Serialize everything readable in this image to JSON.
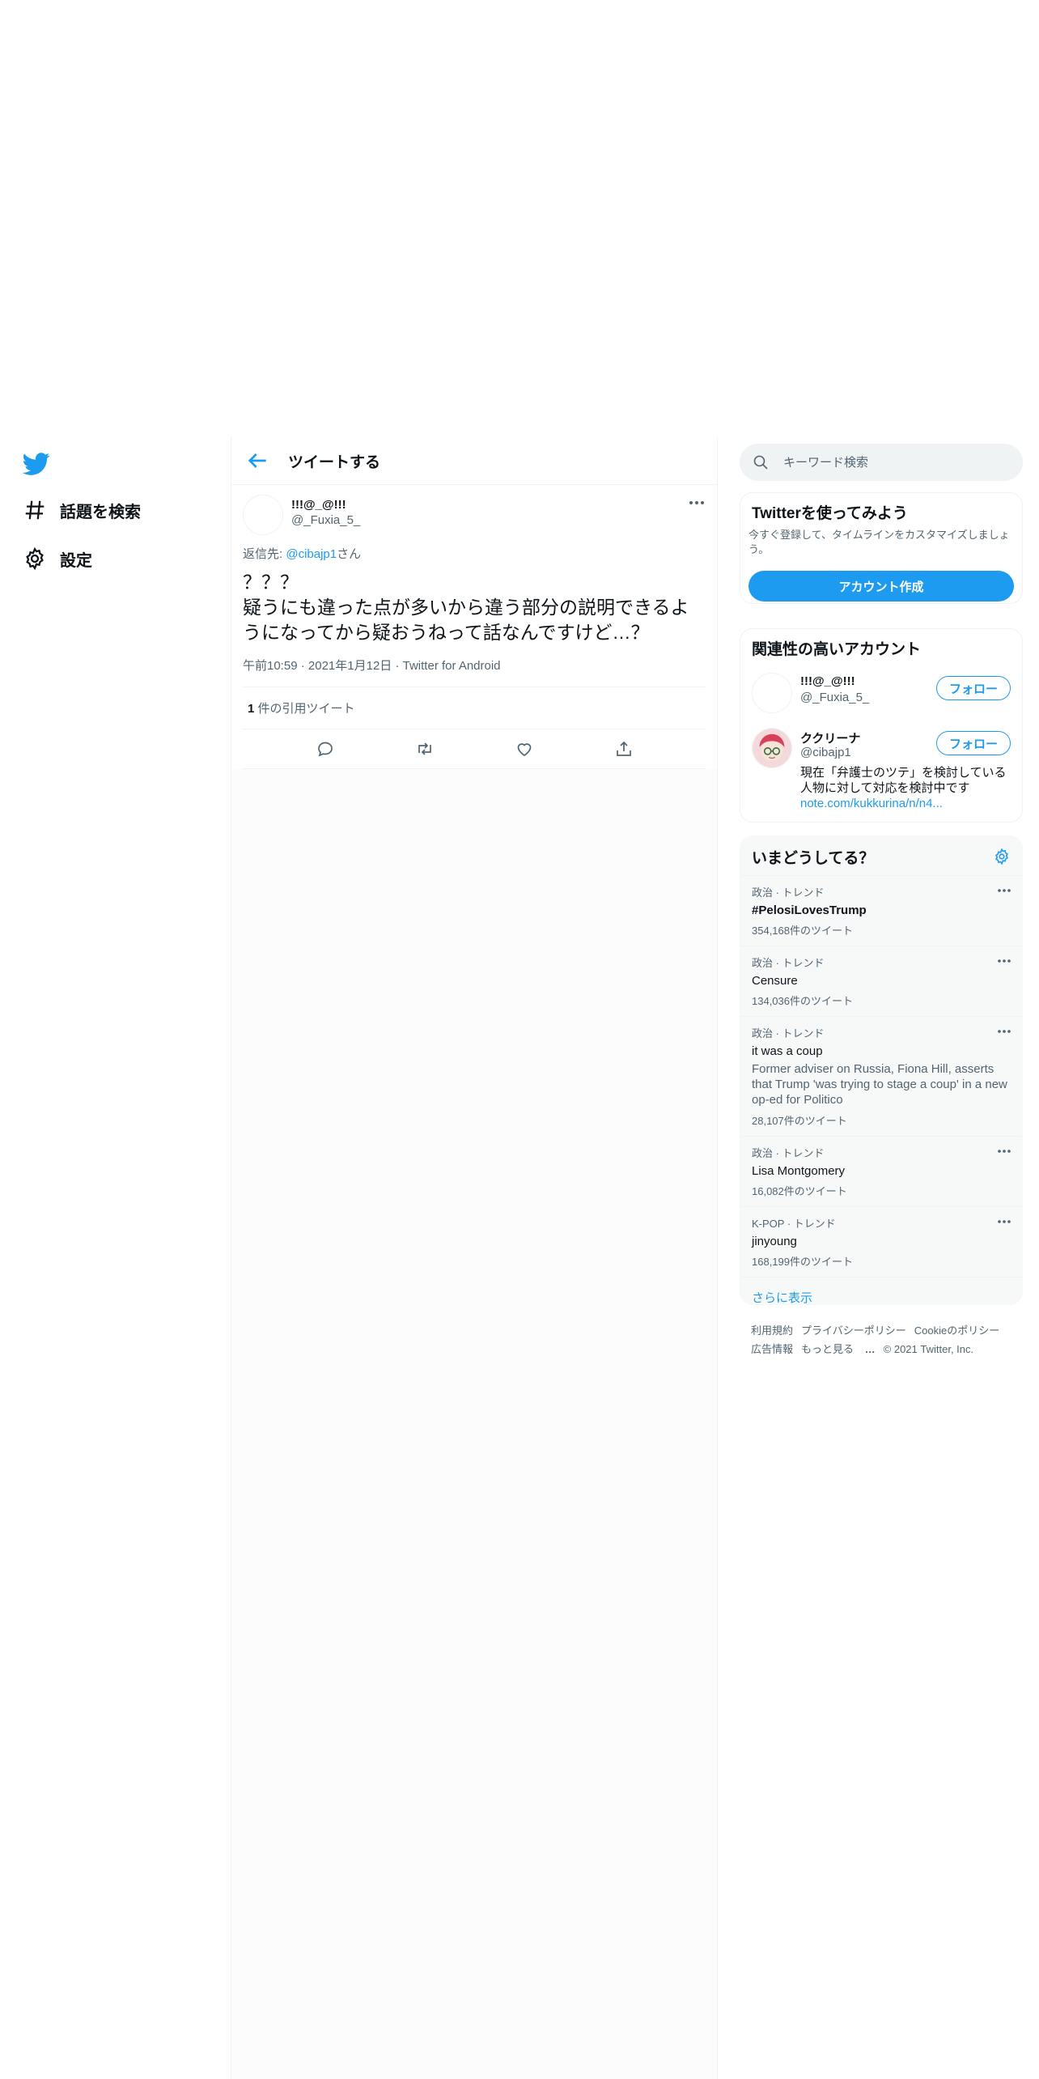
{
  "nav": {
    "explore_label": "話題を検索",
    "settings_label": "設定"
  },
  "header": {
    "title": "ツイートする"
  },
  "tweet": {
    "name": "!!!@_@!!!",
    "handle": "@_Fuxia_5_",
    "reply_prefix": "返信先: ",
    "reply_handle": "@cibajp1",
    "reply_suffix": "さん",
    "text": "？？？\n疑うにも違った点が多いから違う部分の説明できるようになってから疑おうねって話なんですけど…？",
    "time": "午前10:59",
    "date": "2021年1月12日",
    "source": "Twitter for Android",
    "quote_count": "1",
    "quote_label": " 件の引用ツイート"
  },
  "search": {
    "placeholder": "キーワード検索"
  },
  "signup": {
    "title": "Twitterを使ってみよう",
    "subtitle": "今すぐ登録して、タイムラインをカスタマイズしましょう。",
    "button": "アカウント作成"
  },
  "related": {
    "title": "関連性の高いアカウント",
    "follow_label": "フォロー",
    "accounts": [
      {
        "name": "!!!@_@!!!",
        "handle": "@_Fuxia_5_"
      },
      {
        "name": "ククリーナ",
        "handle": "@cibajp1",
        "bio": "現在「弁護士のツテ」を検討している人物に対して対応を検討中です",
        "link": "note.com/kukkurina/n/n4..."
      }
    ]
  },
  "trends": {
    "title": "いまどうしてる？",
    "items": [
      {
        "category": "政治 · トレンド",
        "name": "#PelosiLovesTrump",
        "count": "354,168件のツイート"
      },
      {
        "category": "政治 · トレンド",
        "name": "Censure",
        "count": "134,036件のツイート"
      },
      {
        "category": "政治 · トレンド",
        "name": "it was a coup",
        "desc": "Former adviser on Russia, Fiona Hill, asserts that Trump 'was trying to stage a coup' in a new op-ed for Politico",
        "count": "28,107件のツイート"
      },
      {
        "category": "政治 · トレンド",
        "name": "Lisa Montgomery",
        "count": "16,082件のツイート"
      },
      {
        "category": "K-POP · トレンド",
        "name": "jinyoung",
        "count": "168,199件のツイート"
      }
    ],
    "show_more": "さらに表示"
  },
  "footer": {
    "terms": "利用規約",
    "privacy": "プライバシーポリシー",
    "cookie": "Cookieのポリシー",
    "ads": "広告情報",
    "more": "もっと見る",
    "copyright": "© 2021 Twitter, Inc."
  },
  "colors": {
    "accent": "#1d9bf0",
    "text": "#0f1419",
    "muted": "#536471"
  }
}
